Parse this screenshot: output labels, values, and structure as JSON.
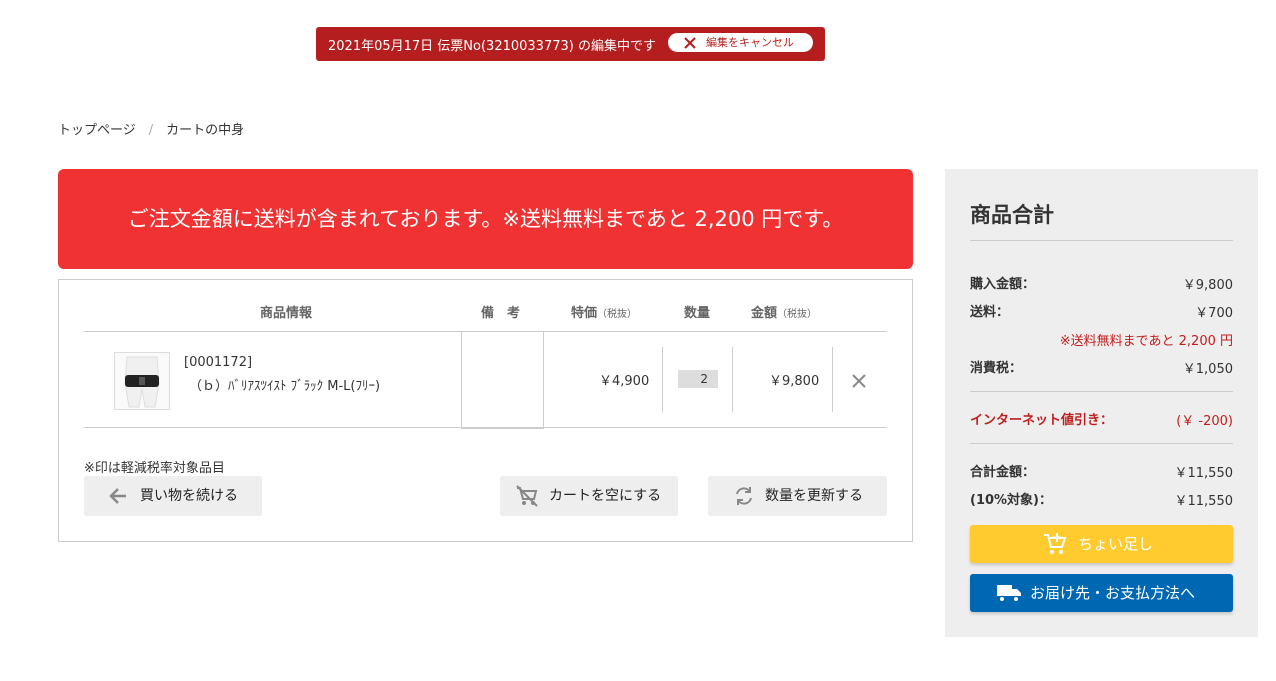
{
  "edit_banner": {
    "text": "2021年05月17日 伝票No(3210033773) の編集中です",
    "cancel_label": "編集をキャンセル",
    "color": "#b51e1e"
  },
  "breadcrumb": {
    "items": [
      "トップページ",
      "カートの中身"
    ],
    "separator": "/"
  },
  "notice": {
    "text": "ご注文金額に送料が含まれております。※送料無料まであと 2,200 円です。",
    "color": "#f03232"
  },
  "cart": {
    "columns": {
      "product_info": "商品情報",
      "remarks": "備　考",
      "special_price": "特価",
      "special_price_note": "（税抜）",
      "quantity": "数量",
      "amount": "金額",
      "amount_note": "（税抜）"
    },
    "items": [
      {
        "code": "[0001172]",
        "name": "（ｂ）ﾊﾞﾘｱｽﾂｲｽﾄ ﾌﾞﾗｯｸ M-L(ﾌﾘｰ)",
        "remarks": "",
        "price": "￥4,900",
        "quantity": "2",
        "amount": "￥9,800",
        "image_icon": "waist-belt-product-photo",
        "remove_icon": "close-icon"
      }
    ],
    "tax_note": "※印は軽減税率対象品目",
    "buttons": {
      "continue_shopping": "買い物を続ける",
      "empty_cart": "カートを空にする",
      "update_quantity": "数量を更新する"
    }
  },
  "summary": {
    "title": "商品合計",
    "purchase_label": "購入金額：",
    "purchase_value": "￥9,800",
    "shipping_label": "送料：",
    "shipping_value": "￥700",
    "free_shipping_note": "※送料無料まであと 2,200 円",
    "tax_label": "消費税：",
    "tax_value": "￥1,050",
    "discount_label": "インターネット値引き：",
    "discount_value": "(￥ -200)",
    "total_label": "合計金額：",
    "total_value": "￥11,550",
    "taxable_label": "(10%対象)：",
    "taxable_value": "￥11,550",
    "add_more_label": "ちょい足し",
    "checkout_label": "お届け先・お支払方法へ",
    "add_more_color": "#ffcb2e",
    "checkout_color": "#0067b3"
  }
}
